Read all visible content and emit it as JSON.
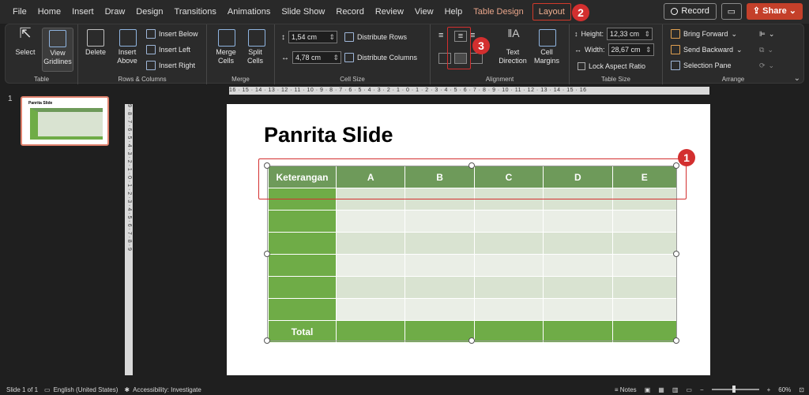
{
  "menu": {
    "tabs": [
      "File",
      "Home",
      "Insert",
      "Draw",
      "Design",
      "Transitions",
      "Animations",
      "Slide Show",
      "Record",
      "Review",
      "View",
      "Help"
    ],
    "table_design": "Table Design",
    "layout": "Layout",
    "record_label": "Record",
    "share_label": "Share"
  },
  "ribbon": {
    "table": {
      "label": "Table",
      "select": "Select",
      "view_gridlines": "View Gridlines"
    },
    "rows_columns": {
      "label": "Rows & Columns",
      "delete": "Delete",
      "insert_above": "Insert Above",
      "insert_below": "Insert Below",
      "insert_left": "Insert Left",
      "insert_right": "Insert Right"
    },
    "merge": {
      "label": "Merge",
      "merge_cells": "Merge Cells",
      "split_cells": "Split Cells"
    },
    "cell_size": {
      "label": "Cell Size",
      "height_value": "1,54 cm",
      "width_value": "4,78 cm",
      "distribute_rows": "Distribute Rows",
      "distribute_columns": "Distribute Columns"
    },
    "alignment": {
      "label": "Alignment",
      "text_direction": "Text Direction",
      "cell_margins": "Cell Margins"
    },
    "table_size": {
      "label": "Table Size",
      "height_label": "Height:",
      "height_value": "12,33 cm",
      "width_label": "Width:",
      "width_value": "28,67 cm",
      "lock_aspect": "Lock Aspect Ratio"
    },
    "arrange": {
      "label": "Arrange",
      "bring_forward": "Bring Forward",
      "send_backward": "Send Backward",
      "selection_pane": "Selection Pane"
    }
  },
  "slides_panel": {
    "slide_number": "1",
    "thumb_title": "Panrita Slide"
  },
  "ruler": {
    "horizontal": "16 · 15 · 14 · 13 · 12 · 11 · 10 · 9 · 8 · 7 · 6 · 5 · 4 · 3 · 2 · 1 · 0 · 1 · 2 · 3 · 4 · 5 · 6 · 7 · 8 · 9 · 10 · 11 · 12 · 13 · 14 · 15 · 16",
    "vertical": "9 · 8 · 7 · 6 · 5 · 4 · 3 · 2 · 1 · 0 · 1 · 2 · 3 · 4 · 5 · 6 · 7 · 8 · 9"
  },
  "slide": {
    "title": "Panrita Slide",
    "table": {
      "headers": [
        "Keterangan",
        "A",
        "B",
        "C",
        "D",
        "E"
      ],
      "total_label": "Total"
    }
  },
  "annotations": {
    "one": "1",
    "two": "2",
    "three": "3"
  },
  "status": {
    "slide_info": "Slide 1 of 1",
    "language": "English (United States)",
    "accessibility": "Accessibility: Investigate",
    "notes": "Notes",
    "zoom": "60%"
  },
  "colors": {
    "accent_red": "#d32f2f",
    "table_header": "#6e9a5a",
    "table_green": "#6fac47"
  }
}
